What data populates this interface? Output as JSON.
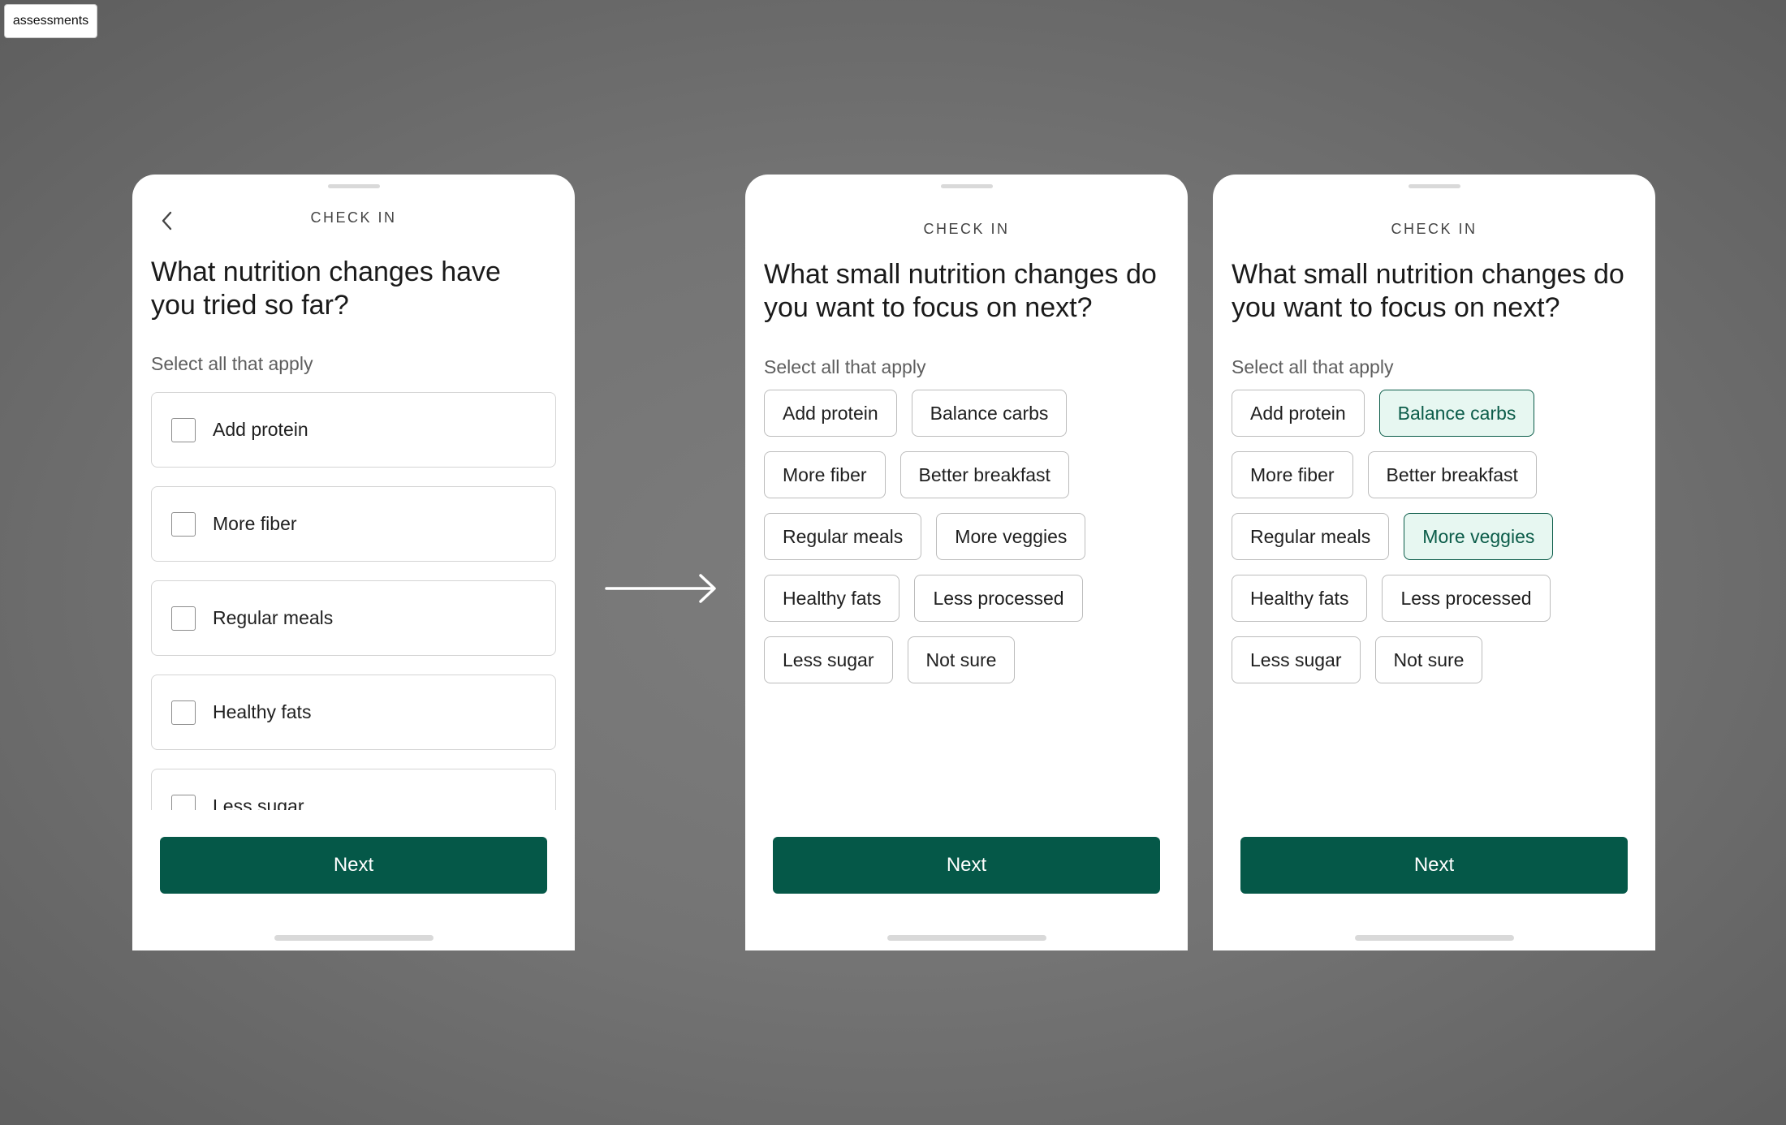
{
  "tag": "assessments",
  "screens": [
    {
      "eyebrow": "CHECK IN",
      "heading": "What nutrition changes have you tried so far?",
      "subtext": "Select all that apply",
      "options": [
        "Add protein",
        "More fiber",
        "Regular meals",
        "Healthy fats",
        "Less sugar"
      ],
      "next_label": "Next",
      "icons": {
        "back": "chevron-left-icon",
        "checkbox": "checkbox-unchecked-icon"
      }
    },
    {
      "eyebrow": "CHECK IN",
      "heading": "What small nutrition changes do you want to focus on next?",
      "subtext": "Select all that apply",
      "chips": [
        {
          "label": "Add protein",
          "selected": false
        },
        {
          "label": "Balance carbs",
          "selected": false
        },
        {
          "label": "More fiber",
          "selected": false
        },
        {
          "label": "Better breakfast",
          "selected": false
        },
        {
          "label": "Regular meals",
          "selected": false
        },
        {
          "label": "More veggies",
          "selected": false
        },
        {
          "label": "Healthy fats",
          "selected": false
        },
        {
          "label": "Less processed",
          "selected": false
        },
        {
          "label": "Less sugar",
          "selected": false
        },
        {
          "label": "Not sure",
          "selected": false
        }
      ],
      "next_label": "Next"
    },
    {
      "eyebrow": "CHECK IN",
      "heading": "What small nutrition changes do you want to focus on next?",
      "subtext": "Select all that apply",
      "chips": [
        {
          "label": "Add protein",
          "selected": false
        },
        {
          "label": "Balance carbs",
          "selected": true
        },
        {
          "label": "More fiber",
          "selected": false
        },
        {
          "label": "Better breakfast",
          "selected": false
        },
        {
          "label": "Regular meals",
          "selected": false
        },
        {
          "label": "More veggies",
          "selected": true
        },
        {
          "label": "Healthy fats",
          "selected": false
        },
        {
          "label": "Less processed",
          "selected": false
        },
        {
          "label": "Less sugar",
          "selected": false
        },
        {
          "label": "Not sure",
          "selected": false
        }
      ],
      "next_label": "Next"
    }
  ],
  "transition_icon": "arrow-right-icon",
  "colors": {
    "primary": "#055848",
    "selected_border": "#0b5c49",
    "selected_fill": "#e7f7f1",
    "chip_border": "#bcbcbc"
  }
}
